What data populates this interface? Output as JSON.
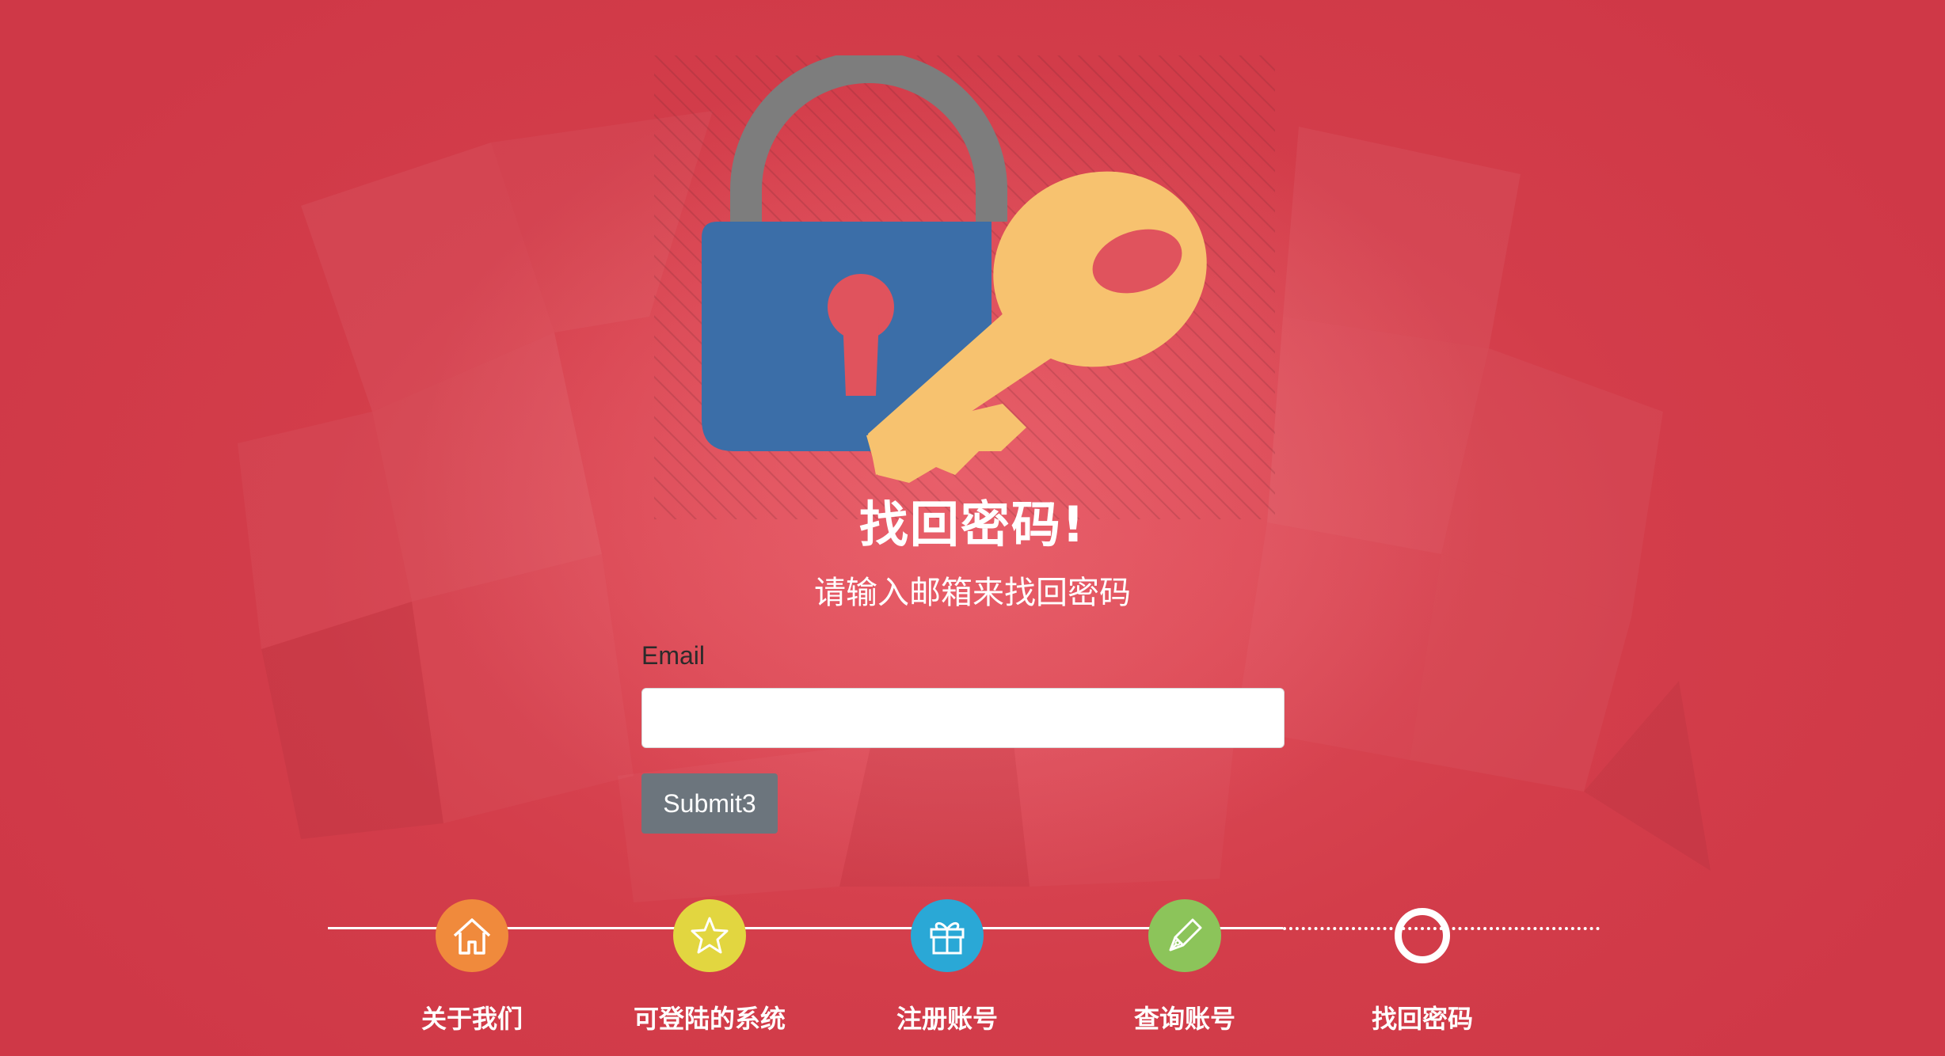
{
  "page": {
    "title": "找回密码!",
    "subtitle": "请输入邮箱来找回密码"
  },
  "form": {
    "email_label": "Email",
    "email_value": "",
    "email_placeholder": "",
    "submit_label": "Submit3"
  },
  "steps": [
    {
      "label": "关于我们",
      "icon": "home-icon",
      "color": "#f08a3c"
    },
    {
      "label": "可登陆的系统",
      "icon": "star-icon",
      "color": "#e2d640"
    },
    {
      "label": "注册账号",
      "icon": "gift-icon",
      "color": "#2aa8d6"
    },
    {
      "label": "查询账号",
      "icon": "pen-icon",
      "color": "#8cc45a"
    },
    {
      "label": "找回密码",
      "icon": "current-step-ring-icon",
      "color": "#ffffff"
    }
  ],
  "colors": {
    "background": "#d33d4a",
    "lock_body": "#3a6fa6",
    "lock_shackle": "#7a7a7a",
    "key": "#f7c070",
    "button": "#6c757d"
  }
}
